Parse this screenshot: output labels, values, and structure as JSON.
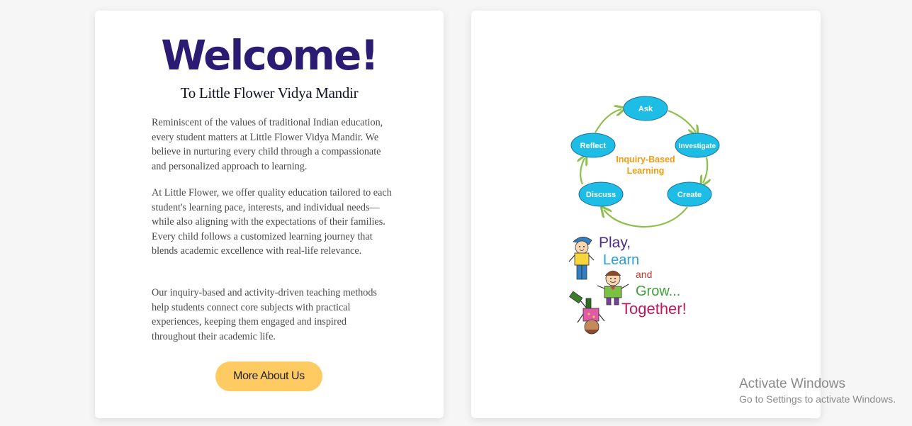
{
  "welcome": {
    "heading": "Welcome!",
    "subtitle": "To Little Flower Vidya Mandir",
    "paragraphs": [
      "Reminiscent of the values of traditional Indian education, every student matters at Little Flower Vidya Mandir. We believe in nurturing every child through a compassionate and personalized approach to learning.",
      "At Little Flower, we offer quality education tailored to each student's learning pace, interests, and individual needs—while also aligning with the expectations of their families. Every child follows a customized learning journey that blends academic excellence with real-life relevance.",
      "Our inquiry-based and activity-driven teaching methods help students connect core subjects with practical experiences, keeping them engaged and inspired throughout their academic life."
    ],
    "button_label": "More About Us"
  },
  "inquiry_cycle": {
    "center_line1": "Inquiry-Based",
    "center_line2": "Learning",
    "nodes": [
      "Ask",
      "Investigate",
      "Create",
      "Discuss",
      "Reflect"
    ]
  },
  "play_learn": {
    "word1": "Play,",
    "word2": "Learn",
    "word3": "and",
    "word4": "Grow...",
    "word5": "Together!"
  },
  "watermark": {
    "title": "Activate Windows",
    "subtitle": "Go to Settings to activate Windows."
  },
  "colors": {
    "heading": "#2b1b73",
    "button": "#fdcb61",
    "node_fill": "#1ebde6",
    "arrow": "#8cc04b",
    "cycle_center": "#f39c12"
  }
}
